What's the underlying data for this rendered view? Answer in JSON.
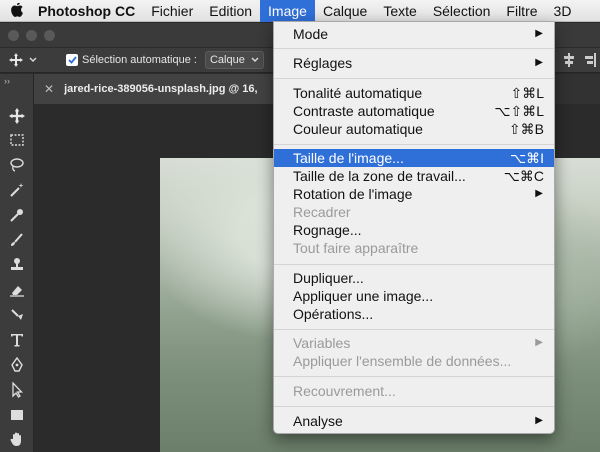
{
  "menubar": {
    "app_name": "Photoshop CC",
    "items": [
      "Fichier",
      "Edition",
      "Image",
      "Calque",
      "Texte",
      "Sélection",
      "Filtre",
      "3D"
    ]
  },
  "options_bar": {
    "auto_select_label": "Sélection automatique :",
    "auto_select_value": "Calque"
  },
  "document_tab": {
    "title": "jared-rice-389056-unsplash.jpg @ 16,"
  },
  "image_menu": {
    "mode": "Mode",
    "reglages": "Réglages",
    "tonalite": {
      "label": "Tonalité automatique",
      "shortcut": "⇧⌘L"
    },
    "contraste": {
      "label": "Contraste automatique",
      "shortcut": "⌥⇧⌘L"
    },
    "couleur": {
      "label": "Couleur automatique",
      "shortcut": "⇧⌘B"
    },
    "taille_image": {
      "label": "Taille de l'image...",
      "shortcut": "⌥⌘I"
    },
    "taille_zone": {
      "label": "Taille de la zone de travail...",
      "shortcut": "⌥⌘C"
    },
    "rotation": "Rotation de l'image",
    "recadrer": "Recadrer",
    "rognage": "Rognage...",
    "tout_faire": "Tout faire apparaître",
    "dupliquer": "Dupliquer...",
    "appliquer_image": "Appliquer une image...",
    "operations": "Opérations...",
    "variables": "Variables",
    "appliquer_donnees": "Appliquer l'ensemble de données...",
    "recouvrement": "Recouvrement...",
    "analyse": "Analyse"
  },
  "colors": {
    "highlight": "#2f6fd8",
    "menu_bg": "#efefef",
    "ps_dark": "#3c3c3c"
  }
}
